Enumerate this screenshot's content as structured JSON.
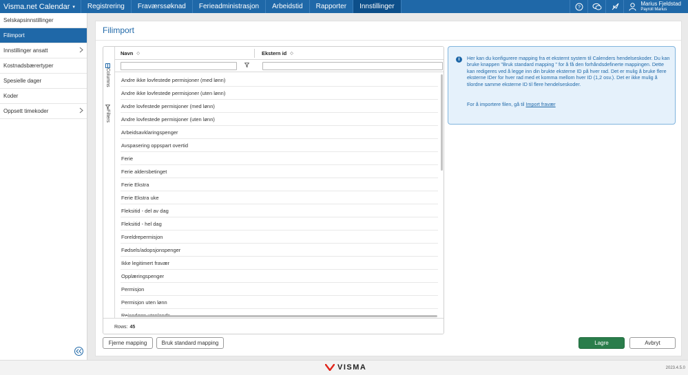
{
  "app": {
    "brand": "Visma.net Calendar",
    "nav": [
      "Registrering",
      "Fraværssøknad",
      "Ferieadministrasjon",
      "Arbeidstid",
      "Rapporter",
      "Innstillinger"
    ],
    "active_nav": "Innstillinger",
    "user_name": "Marius Fjeldstad",
    "user_sub": "Payroll Marius",
    "accent": "#1f68a8"
  },
  "sidebar": {
    "items": [
      {
        "label": "Selskapsinnstillinger",
        "chevron": false
      },
      {
        "label": "Filimport",
        "chevron": false,
        "active": true
      },
      {
        "label": "Innstillinger ansatt",
        "chevron": true
      },
      {
        "label": "Kostnadsbærertyper",
        "chevron": false
      },
      {
        "label": "Spesielle dager",
        "chevron": false
      },
      {
        "label": "Koder",
        "chevron": false
      },
      {
        "label": "Oppsett timekoder",
        "chevron": true
      }
    ]
  },
  "page": {
    "title": "Filimport"
  },
  "grid": {
    "side_tabs": [
      "Columns",
      "Filters"
    ],
    "columns": [
      "Navn",
      "Ekstern id"
    ],
    "rows": [
      "Andre ikke lovfestede permisjoner (med lønn)",
      "Andre ikke lovfestede permisjoner (uten lønn)",
      "Andre lovfestede permisjoner (med lønn)",
      "Andre lovfestede permisjoner (uten lønn)",
      "Arbeidsavklaringspenger",
      "Avspasering oppspart overtid",
      "Ferie",
      "Ferie aldersbetinget",
      "Ferie Ekstra",
      "Ferie Ekstra uke",
      "Fleksitid - del av dag",
      "Fleksitid - hel dag",
      "Foreldrepermisjon",
      "Fødsels/adopsjonspenger",
      "Ikke legitimert fravær",
      "Opplæringspenger",
      "Permisjon",
      "Permisjon uten lønn",
      "Reisedøgn utenlands"
    ],
    "rows_label": "Rows:",
    "rows_count": "45"
  },
  "info": {
    "text": "Her kan du konfigurere mapping fra et eksternt system til Calenders hendelseskoder. Du kan bruke knappen \"Bruk standard mapping \" for å få den forhåndsdefinerte mappingen. Dette kan redigeres ved å legge inn din brukte eksterne ID på hver rad. Det er mulig å bruke flere eksterne IDer for hver rad med et komma mellom hver ID (1,2 osv.). Det er ikke mulig å tilordne samme eksterne ID til flere hendelseskoder.",
    "import_prefix": "For å importere filen, gå til",
    "import_link": "Import fravær"
  },
  "buttons": {
    "remove_mapping": "Fjerne mapping",
    "standard_mapping": "Bruk standard mapping",
    "save": "Lagre",
    "cancel": "Avbryt"
  },
  "footer": {
    "logo": "VISMA",
    "version": "2023.4.5.0"
  }
}
